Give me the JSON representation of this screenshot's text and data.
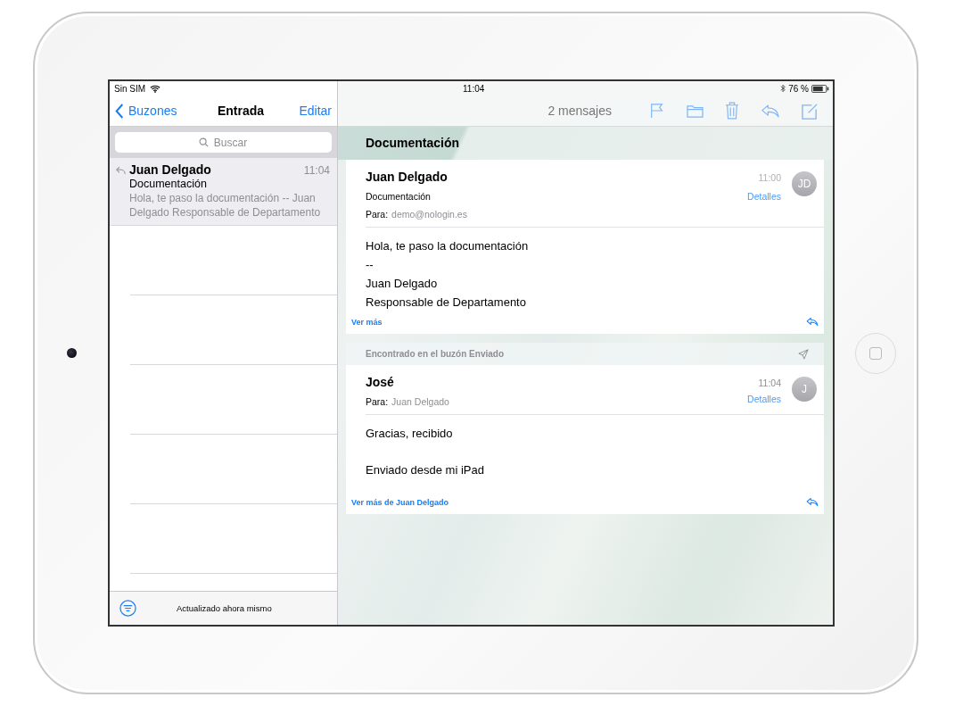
{
  "status_bar": {
    "carrier": "Sin SIM",
    "time": "11:04",
    "battery": "76 %"
  },
  "sidebar": {
    "back": "Buzones",
    "title": "Entrada",
    "edit": "Editar",
    "search": {
      "placeholder": "Buscar"
    },
    "messages": [
      {
        "sender": "Juan Delgado",
        "time": "11:04",
        "subject": "Documentación",
        "preview": "Hola, te paso la documentación -- Juan Delgado Responsable de Departamento",
        "selected": true,
        "replied": true
      }
    ],
    "footer": "Actualizado ahora mismo"
  },
  "thread": {
    "count": "2 mensajes",
    "subject": "Documentación",
    "messages": [
      {
        "kind": "received",
        "sender": "Juan Delgado",
        "subject": "Documentación",
        "to_label": "Para:",
        "to": "demo@nologin.es",
        "time": "11:00",
        "details": "Detalles",
        "initials": "JD",
        "body": [
          "Hola, te paso la documentación\n--\nJuan Delgado\nResponsable de Departamento"
        ],
        "more": "Ver más"
      },
      {
        "kind": "sent",
        "found_in": "Encontrado en el buzón Enviado",
        "sender": "José",
        "to_label": "Para:",
        "to": "Juan Delgado",
        "time": "11:04",
        "details": "Detalles",
        "initials": "J",
        "body": [
          "Gracias, recibido",
          "Enviado desde mi iPad"
        ],
        "more": "Ver más de Juan Delgado"
      }
    ]
  }
}
